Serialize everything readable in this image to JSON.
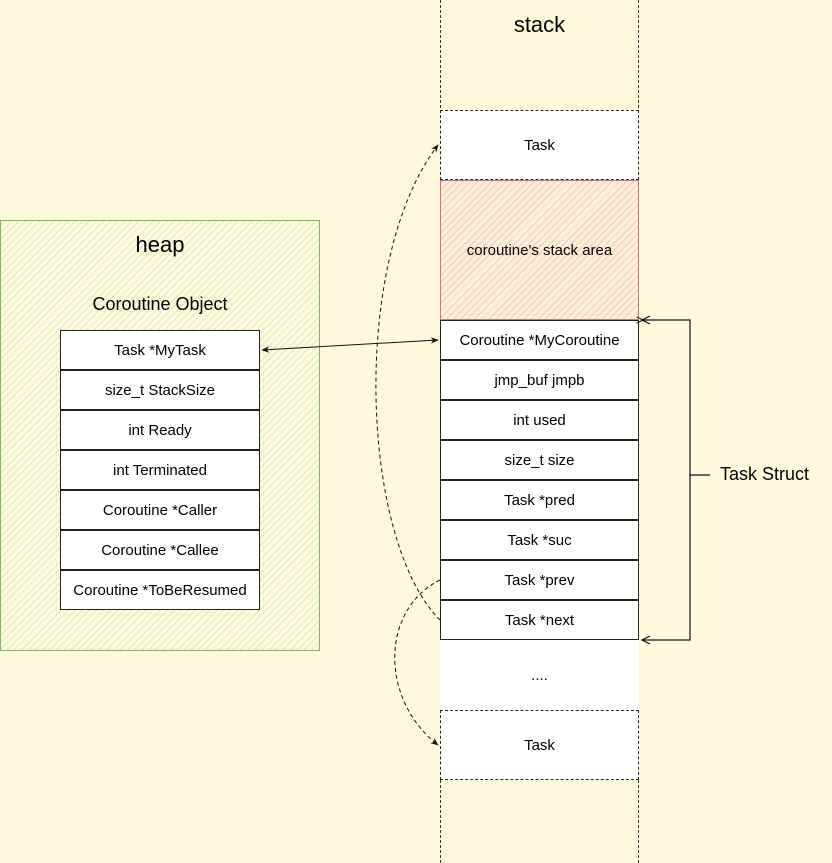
{
  "stack": {
    "title": "stack",
    "top_task_label": "Task",
    "stack_area_label": "coroutine's stack area",
    "task_struct_fields": [
      "Coroutine *MyCoroutine",
      "jmp_buf jmpb",
      "int used",
      "size_t size",
      "Task *pred",
      "Task *suc",
      "Task *prev",
      "Task *next"
    ],
    "ellipsis_label": "....",
    "bottom_task_label": "Task",
    "brace_label": "Task Struct"
  },
  "heap": {
    "title": "heap",
    "object_title": "Coroutine Object",
    "fields": [
      "Task *MyTask",
      "size_t StackSize",
      "int Ready",
      "int Terminated",
      "Coroutine *Caller",
      "Coroutine *Callee",
      "Coroutine *ToBeResumed"
    ]
  },
  "colors": {
    "background": "#fef8dc",
    "heap_border": "#82b366",
    "stack_area_border": "#cc7777"
  }
}
